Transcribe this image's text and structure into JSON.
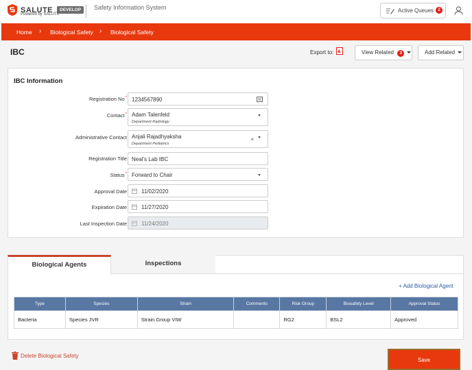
{
  "header": {
    "logo_text": "SALUTE",
    "env_badge": "DEVELOP",
    "powered_by": "Powered by SALUTE",
    "system_name": "Safety Information System",
    "active_queues_label": "Active Queues",
    "active_queues_count": "2"
  },
  "breadcrumb": [
    "Home",
    "Biological Safety",
    "Biological Safety"
  ],
  "page": {
    "title": "IBC",
    "export_label": "Export to:",
    "view_related_label": "View Related",
    "view_related_count": "3",
    "add_related_label": "Add Related"
  },
  "ibc_info": {
    "title": "IBC Information",
    "fields": {
      "registration_no": {
        "label": "Registration No",
        "value": "1234567890",
        "required": "*"
      },
      "contact": {
        "label": "Contact",
        "value": "Adam Talenfeld",
        "sub": "Department Radiology",
        "required": "*"
      },
      "admin_contact": {
        "label": "Administrative Contact",
        "value": "Anjali Rajadhyaksha",
        "sub": "Department Pediatrics",
        "clear": "×"
      },
      "registration_title": {
        "label": "Registration Title",
        "value": "Neal's Lab IBC"
      },
      "status": {
        "label": "Status",
        "value": "Forward to Chair",
        "required": "*"
      },
      "approval_date": {
        "label": "Approval Date",
        "value": "11/02/2020"
      },
      "expiration_date": {
        "label": "Expiration Date",
        "value": "11/27/2020"
      },
      "last_inspection_date": {
        "label": "Last Inspection Date",
        "value": "11/24/2020"
      }
    }
  },
  "tabs": [
    {
      "label": "Biological Agents",
      "active": true
    },
    {
      "label": "Inspections",
      "active": false
    }
  ],
  "agents": {
    "add_label": "+ Add Biological Agent",
    "columns": [
      "Type",
      "Species",
      "Strain",
      "Comments",
      "Risk Group",
      "Biosafety Level",
      "Approval Status"
    ],
    "rows": [
      [
        "Bacteria",
        "Species JVR",
        "Strain Group VIW",
        "",
        "RG2",
        "BSL2",
        "Approved"
      ]
    ]
  },
  "footer": {
    "delete_label": "Delete Biological Safety",
    "save_label": "Save"
  },
  "colors": {
    "brand_orange": "#e8380d",
    "badge_red": "#e21f17",
    "table_header": "#5877a3",
    "link_blue": "#2c5a9e"
  },
  "icons": [
    "salute-logo-icon",
    "edit-queue-icon",
    "user-icon",
    "chevron-right-icon",
    "pdf-icon",
    "caret-down-icon",
    "keypad-icon",
    "calendar-icon",
    "clear-icon",
    "trash-icon"
  ]
}
